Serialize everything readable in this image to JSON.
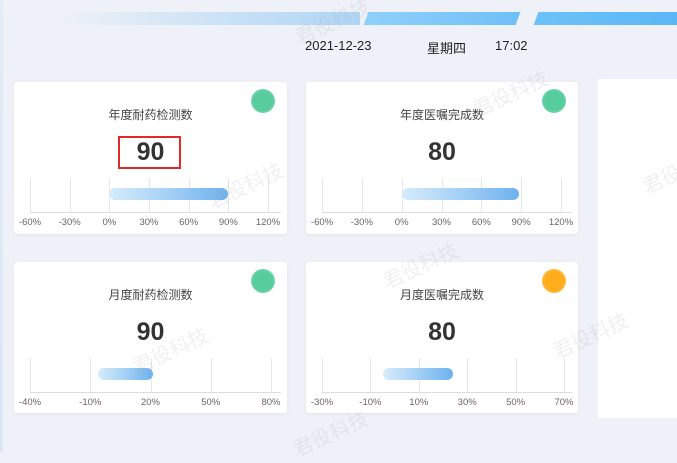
{
  "header": {
    "date": "2021-12-23",
    "weekday": "星期四",
    "time": "17:02"
  },
  "cards": [
    {
      "title": "年度耐药检测数",
      "value": "90",
      "status": "green",
      "ticks": [
        "-60%",
        "-30%",
        "0%",
        "30%",
        "60%",
        "90%",
        "120%"
      ],
      "bar_range": [
        0,
        0.9
      ]
    },
    {
      "title": "年度医嘱完成数",
      "value": "80",
      "status": "green",
      "ticks": [
        "-60%",
        "-30%",
        "0%",
        "30%",
        "60%",
        "90%",
        "120%"
      ],
      "bar_range": [
        0,
        0.88
      ]
    },
    {
      "title": "月度耐药检测数",
      "value": "90",
      "status": "green",
      "ticks": [
        "-40%",
        "-10%",
        "20%",
        "50%",
        "80%"
      ],
      "bar_range": [
        -0.06,
        0.21
      ]
    },
    {
      "title": "月度医嘱完成数",
      "value": "80",
      "status": "orange",
      "ticks": [
        "-30%",
        "-10%",
        "10%",
        "30%",
        "50%",
        "70%"
      ],
      "bar_range": [
        -0.05,
        0.24
      ]
    }
  ],
  "colors": {
    "green": "#57cc9d",
    "orange": "#ffad1c",
    "highlight_box": "#e02a2a"
  },
  "watermark": "君役科技"
}
